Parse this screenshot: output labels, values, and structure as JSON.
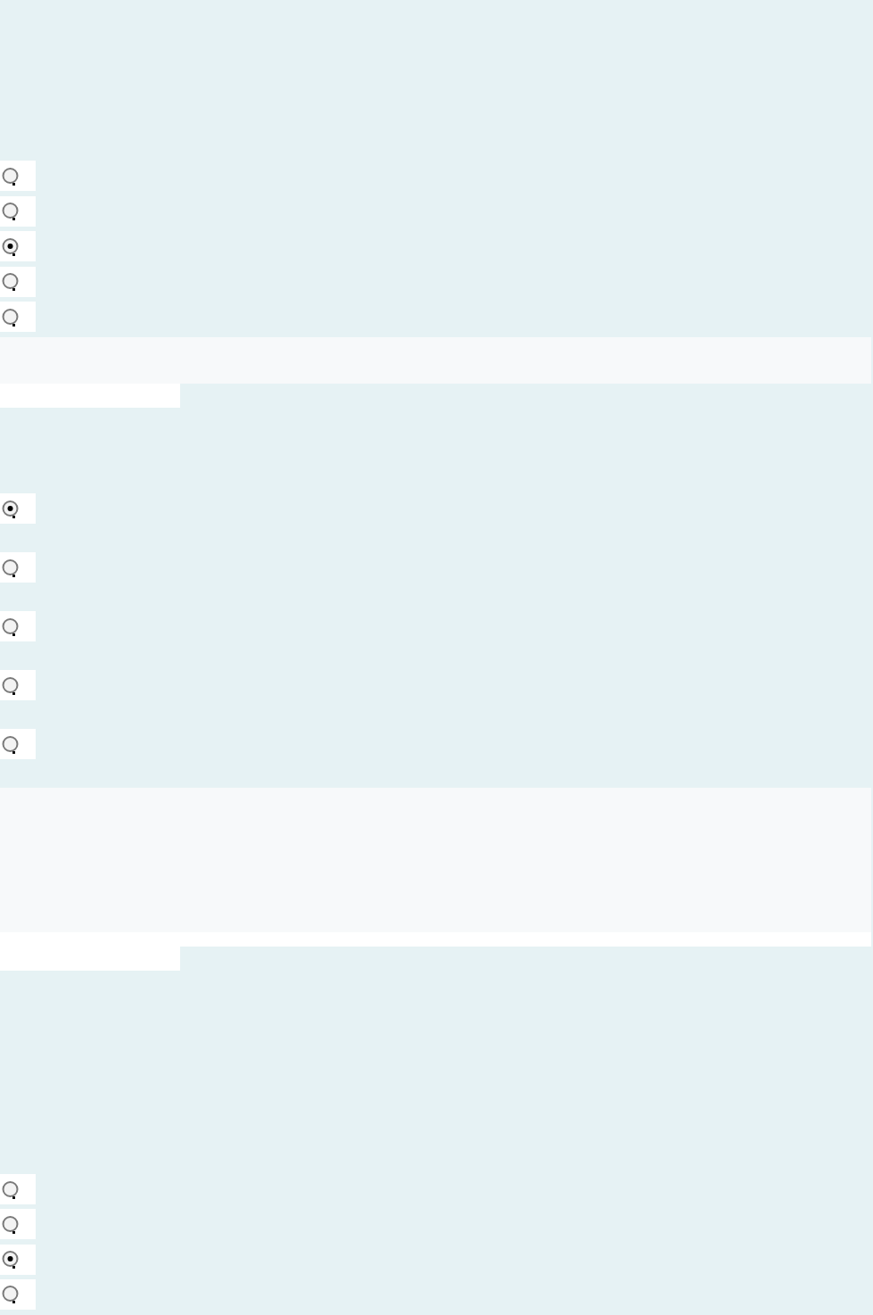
{
  "questions": [
    {
      "options": [
        {
          "selected": false
        },
        {
          "selected": false
        },
        {
          "selected": true
        },
        {
          "selected": false
        },
        {
          "selected": false
        }
      ]
    },
    {
      "options": [
        {
          "selected": true
        },
        {
          "selected": false
        },
        {
          "selected": false
        },
        {
          "selected": false
        },
        {
          "selected": false
        }
      ]
    },
    {
      "options": [
        {
          "selected": false
        },
        {
          "selected": false
        },
        {
          "selected": true
        },
        {
          "selected": false
        }
      ]
    }
  ]
}
